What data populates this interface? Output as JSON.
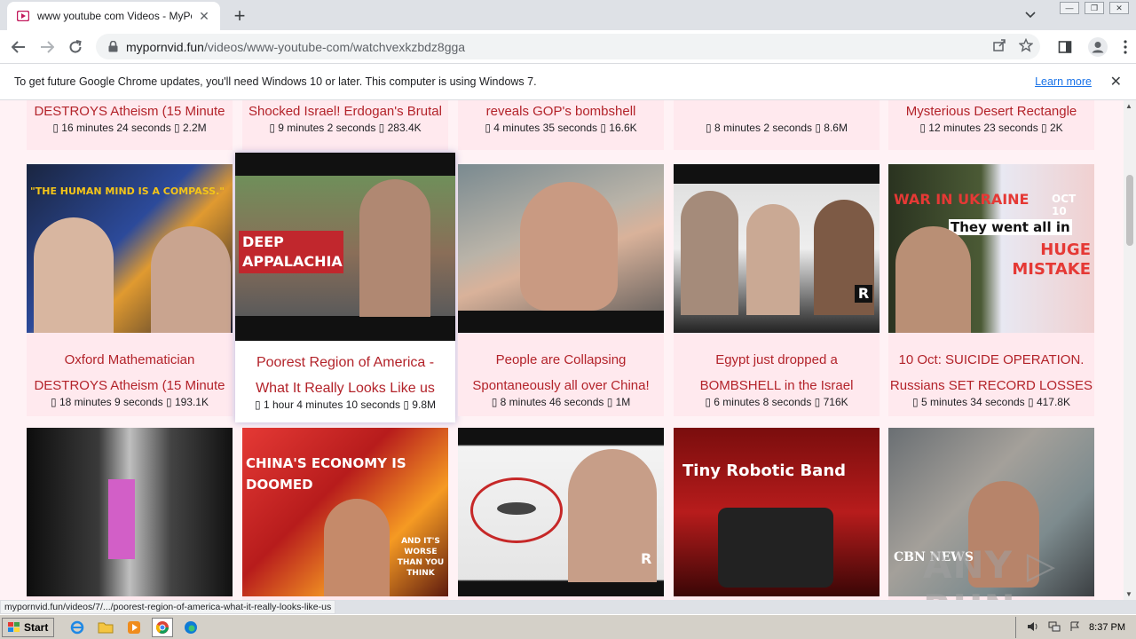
{
  "browser": {
    "tab": {
      "title": "www youtube com Videos - MyPornVid"
    },
    "url_host": "mypornvid.fun",
    "url_path": "/videos/www-youtube-com/watchvexkzbdz8gga",
    "infobar": {
      "message": "To get future Google Chrome updates, you'll need Windows 10 or later. This computer is using Windows 7.",
      "link": "Learn more"
    },
    "status_url": "mypornvid.fun/videos/7/.../poorest-region-of-america-what-it-really-looks-like-us"
  },
  "top_row": [
    {
      "title": "DESTROYS Atheism (15 Minute",
      "meta": "▯ 16 minutes 24 seconds ▯ 2.2M"
    },
    {
      "title": "Shocked Israel! Erdogan's Brutal",
      "meta": "▯ 9 minutes 2 seconds ▯ 283.4K"
    },
    {
      "title": "reveals GOP's bombshell",
      "meta": "▯ 4 minutes 35 seconds ▯ 16.6K"
    },
    {
      "title": "",
      "meta": "▯ 8 minutes 2 seconds ▯ 8.6M"
    },
    {
      "title": "Mysterious Desert Rectangle",
      "meta": "▯ 12 minutes 23 seconds ▯ 2K"
    }
  ],
  "middle_row": [
    {
      "line1": "Oxford Mathematician",
      "line2": "DESTROYS Atheism (15 Minute",
      "meta": "▯ 18 minutes 9 seconds ▯ 193.1K",
      "caption": "\"THE HUMAN MIND IS A COMPASS.\""
    },
    {
      "line1": "Poorest Region of America -",
      "line2": "What It Really Looks Like us",
      "meta": "▯ 1 hour 4 minutes 10 seconds ▯ 9.8M",
      "caption": "DEEP APPALACHIA"
    },
    {
      "line1": "People are Collapsing",
      "line2": "Spontaneously all over China!",
      "meta": "▯ 8 minutes 46 seconds ▯ 1M",
      "caption": ""
    },
    {
      "line1": "Egypt just dropped a",
      "line2": "BOMBSHELL in the Israel",
      "meta": "▯ 6 minutes 8 seconds ▯ 716K",
      "caption": "R"
    },
    {
      "line1": "10 Oct: SUICIDE OPERATION.",
      "line2": "Russians SET RECORD LOSSES",
      "meta": "▯ 5 minutes 34 seconds ▯ 417.8K",
      "caption": "WAR IN UKRAINE",
      "caption2": "OCT 10",
      "caption3": "They went all in",
      "caption4": "HUGE MISTAKE"
    }
  ],
  "bottom_row": [
    {
      "caption": ""
    },
    {
      "caption": "CHINA'S ECONOMY IS DOOMED",
      "caption2": "AND IT'S WORSE THAN YOU THINK"
    },
    {
      "caption": "R"
    },
    {
      "caption": "Tiny Robotic Band"
    },
    {
      "caption": "CBN NEWS"
    }
  ],
  "watermark": "ANY ▷ RUN",
  "taskbar": {
    "start": "Start",
    "clock": "8:37 PM"
  }
}
